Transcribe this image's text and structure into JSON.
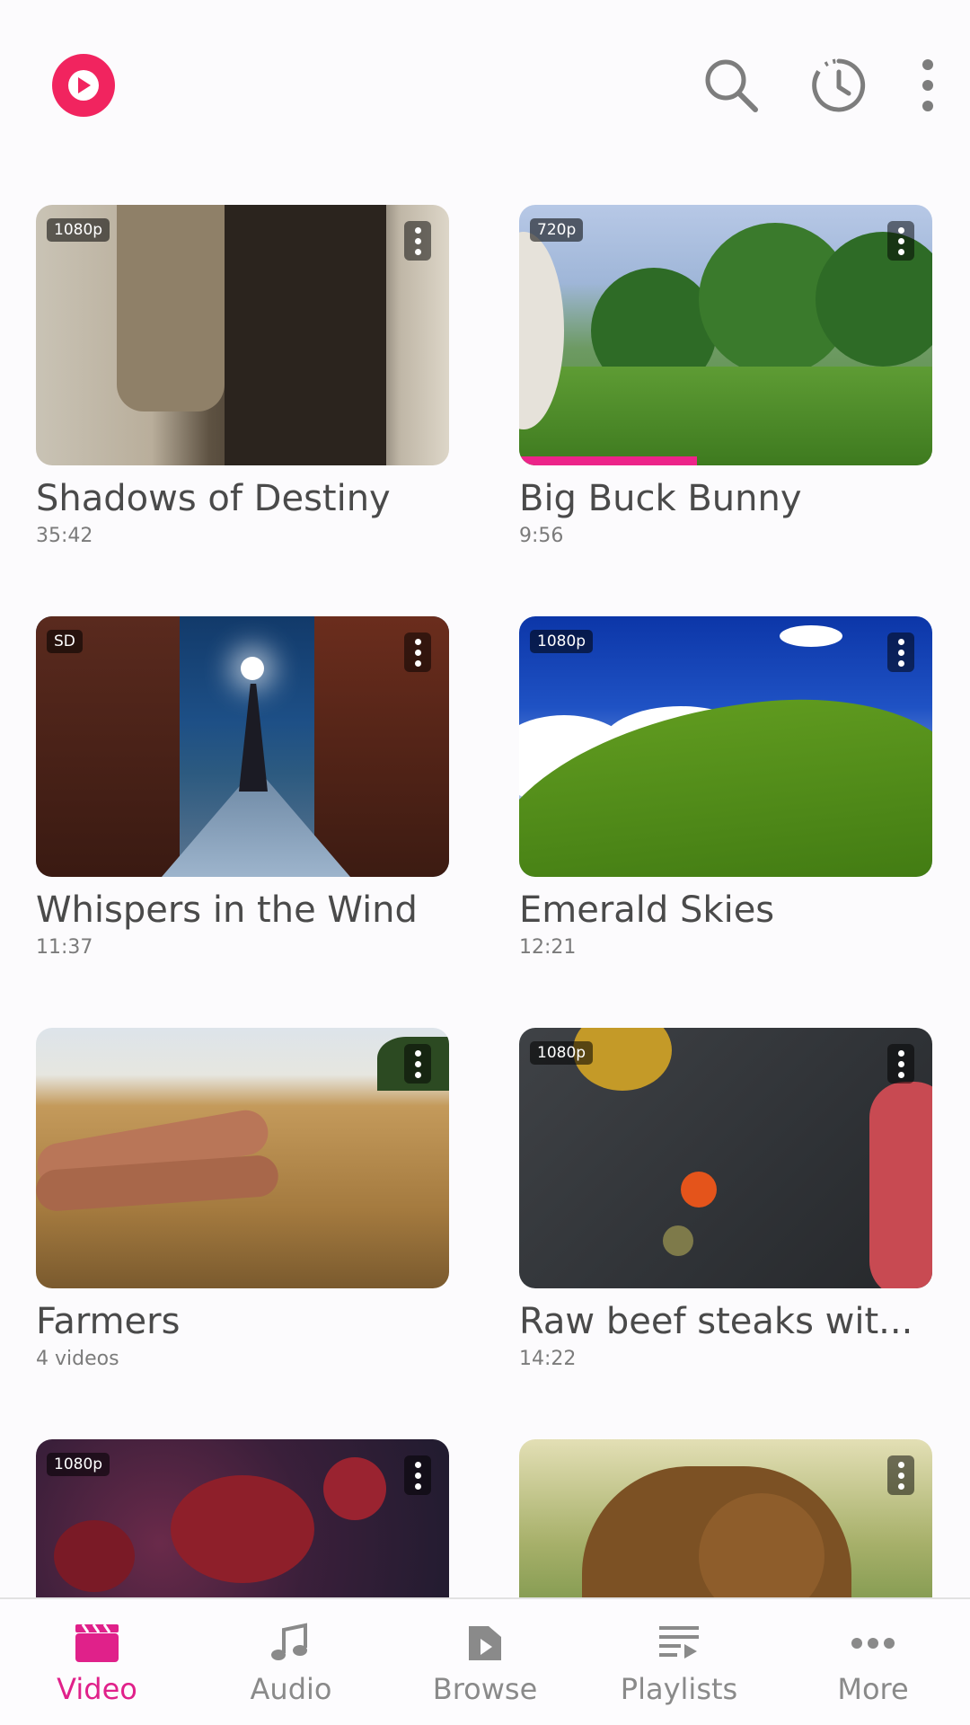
{
  "colors": {
    "accent": "#e0218a",
    "logo": "#f1245f",
    "progress": "#ec2489",
    "title_text": "#4a4a4a",
    "meta_text": "#7b7b7b",
    "icon_gray": "#7d7d7d"
  },
  "header": {
    "logo_icon": "play-circle-icon",
    "actions": [
      "search-icon",
      "history-icon",
      "more-vertical-icon"
    ]
  },
  "videos": [
    {
      "title": "Shadows of Destiny",
      "meta": "35:42",
      "badge": "1080p",
      "progress": 0
    },
    {
      "title": "Big Buck Bunny",
      "meta": "9:56",
      "badge": "720p",
      "progress": 0.43
    },
    {
      "title": "Whispers in the Wind",
      "meta": "11:37",
      "badge": "SD",
      "progress": 0
    },
    {
      "title": "Emerald Skies",
      "meta": "12:21",
      "badge": "1080p",
      "progress": 0
    },
    {
      "title": "Farmers",
      "meta": "4 videos",
      "badge": "",
      "progress": 0
    },
    {
      "title": "Raw beef steaks wit...",
      "meta": "14:22",
      "badge": "1080p",
      "progress": 0
    },
    {
      "title": "",
      "meta": "",
      "badge": "1080p",
      "progress": 0
    },
    {
      "title": "",
      "meta": "",
      "badge": "",
      "progress": 0
    }
  ],
  "bottom_nav": {
    "items": [
      {
        "label": "Video",
        "icon": "clapperboard-icon",
        "active": true
      },
      {
        "label": "Audio",
        "icon": "music-note-icon",
        "active": false
      },
      {
        "label": "Browse",
        "icon": "folder-icon",
        "active": false
      },
      {
        "label": "Playlists",
        "icon": "playlist-icon",
        "active": false
      },
      {
        "label": "More",
        "icon": "more-horizontal-icon",
        "active": false
      }
    ]
  }
}
